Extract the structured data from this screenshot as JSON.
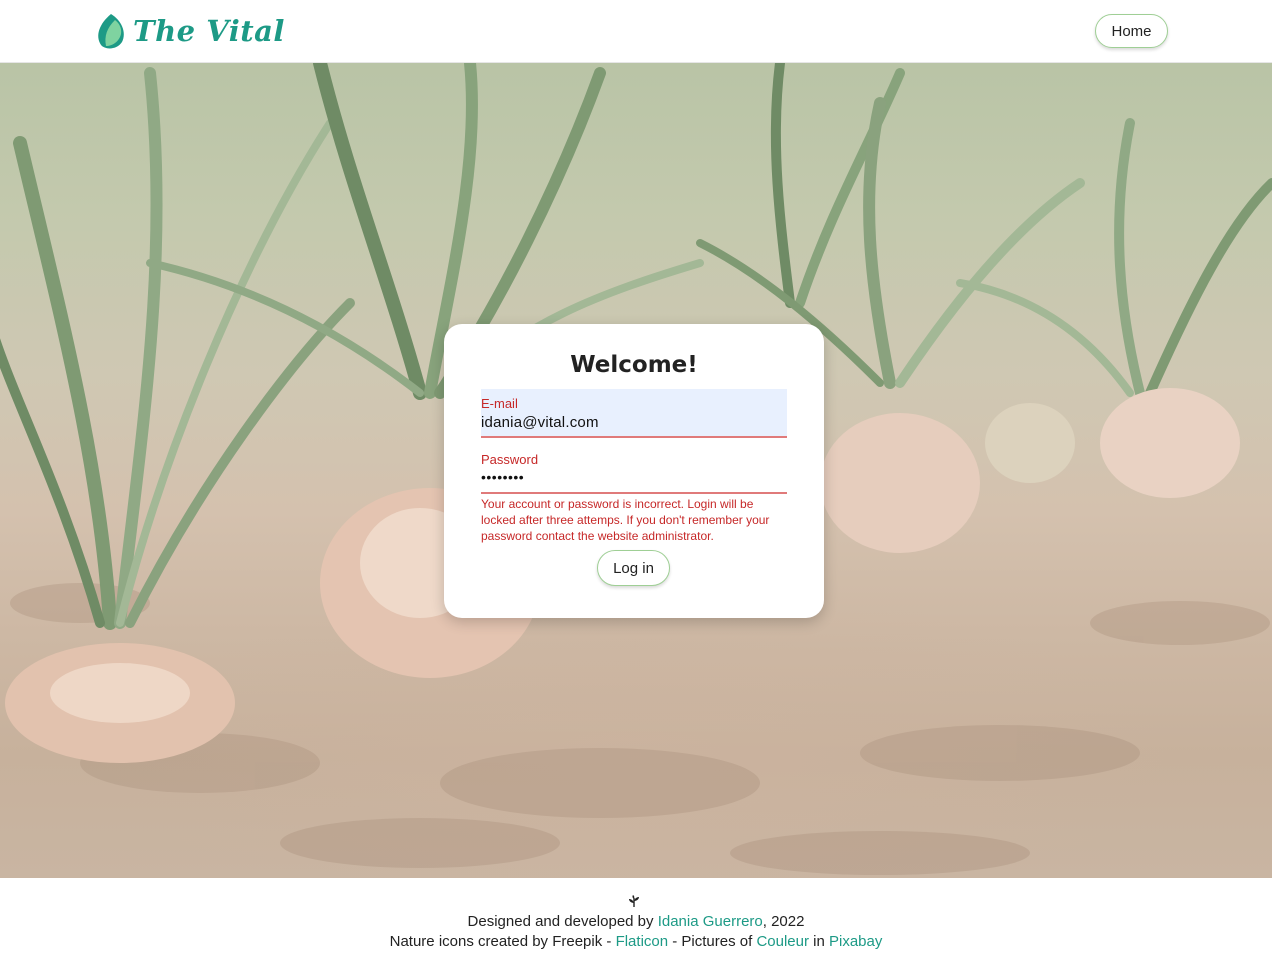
{
  "header": {
    "logo_text": "The Vital",
    "home_label": "Home"
  },
  "login": {
    "title": "Welcome!",
    "email_label": "E-mail",
    "email_value": "idania@vital.com",
    "password_label": "Password",
    "password_value": "••••••••",
    "error": "Your account or password is incorrect. Login will be locked after three attemps. If you don't remember your password contact the website administrator.",
    "submit_label": "Log in"
  },
  "footer": {
    "line1_prefix": "Designed and developed by ",
    "author_link": "Idania Guerrero",
    "line1_suffix": ", 2022",
    "line2_prefix": "Nature icons created by Freepik - ",
    "flaticon_link": "Flaticon",
    "line2_mid": " - Pictures of ",
    "couleur_link": "Couleur",
    "line2_in": " in ",
    "pixabay_link": "Pixabay"
  },
  "colors": {
    "brand": "#1d9a86",
    "error": "#c62828",
    "button_border": "#9fcf95",
    "autofill_bg": "#e8f0fe"
  }
}
